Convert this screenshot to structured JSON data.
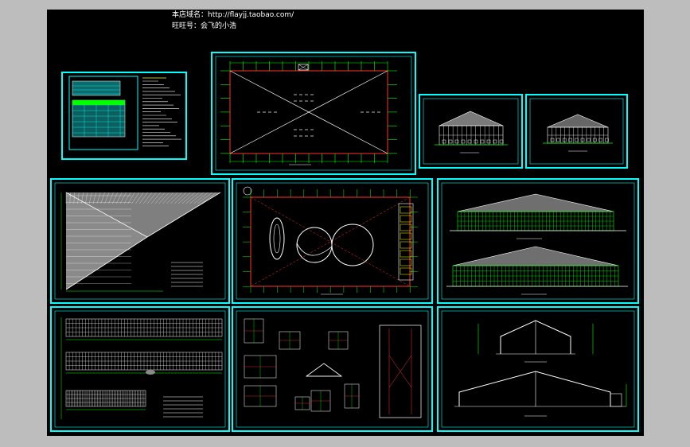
{
  "header": {
    "shop_line": "本店域名：http://flayjj.taobao.com/",
    "contact_line": "旺旺号：会飞的小浩"
  },
  "colors": {
    "canvas": "#000000",
    "frame": "#00ffff",
    "line_green": "#00ff00",
    "line_red": "#ff3030",
    "line_white": "#ffffff",
    "line_yellow": "#ffff00",
    "fill_gray": "#808080",
    "desk": "#bdbdbd"
  },
  "sheets": [
    {
      "id": "notes",
      "kind": "notes-table"
    },
    {
      "id": "roof-plan",
      "kind": "plan-cross"
    },
    {
      "id": "elevation-front-a",
      "kind": "elevation-small"
    },
    {
      "id": "elevation-front-b",
      "kind": "elevation-small"
    },
    {
      "id": "roof-truss",
      "kind": "truss-triangle"
    },
    {
      "id": "floor-plan",
      "kind": "plan-pools"
    },
    {
      "id": "long-elevations",
      "kind": "elevation-long"
    },
    {
      "id": "side-grids",
      "kind": "grid-rows"
    },
    {
      "id": "details",
      "kind": "details"
    },
    {
      "id": "sections",
      "kind": "sections"
    }
  ]
}
